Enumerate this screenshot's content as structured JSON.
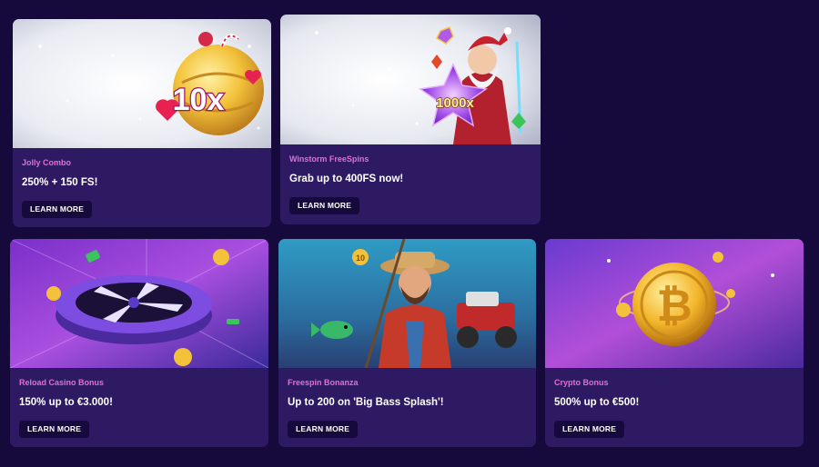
{
  "promos": [
    {
      "category": "Jolly Combo",
      "headline": "250% + 150 FS!",
      "button": "LEARN MORE",
      "art_text": "10x",
      "art_icon": "golden-ornament-icon"
    },
    {
      "category": "Winstorm FreeSpins",
      "headline": "Grab up to 400FS now!",
      "button": "LEARN MORE",
      "art_text": "1000x",
      "art_icon": "santa-character-icon"
    },
    {
      "category": "Reload Casino Bonus",
      "headline": "150% up to €3.000!",
      "button": "LEARN MORE",
      "art_icon": "roulette-wheel-icon"
    },
    {
      "category": "Freespin Bonanza",
      "headline": "Up to 200 on 'Big Bass Splash'!",
      "button": "LEARN MORE",
      "art_text": "10",
      "art_icon": "fisherman-character-icon"
    },
    {
      "category": "Crypto Bonus",
      "headline": "500% up to €500!",
      "button": "LEARN MORE",
      "art_icon": "bitcoin-coin-icon"
    }
  ],
  "colors": {
    "page_bg": "#150a3b",
    "card_bg": "#2e1a63",
    "category_text": "#e16fd0",
    "button_bg": "#150a3b",
    "accent_gold": "#f3c23a"
  }
}
